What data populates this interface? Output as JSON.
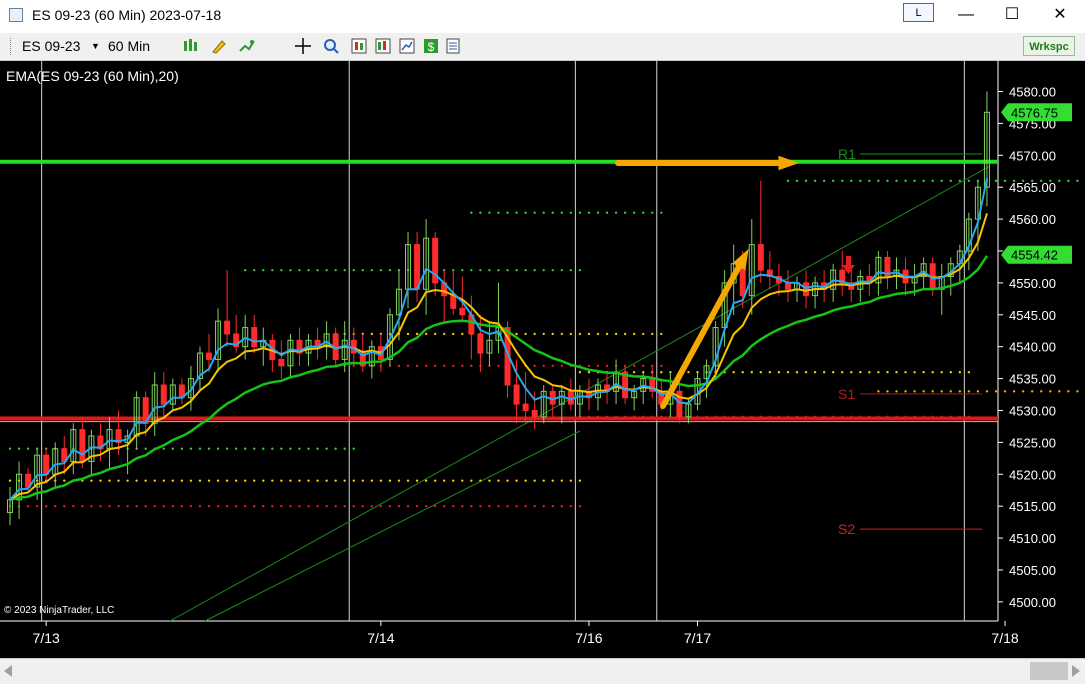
{
  "window": {
    "title": "ES 09-23 (60 Min)  2023-07-18",
    "layout_button": "L",
    "minimize": "—",
    "maximize": "☐",
    "close": "✕"
  },
  "toolbar": {
    "instrument": "ES 09-23",
    "interval": "60 Min",
    "workspace_button": "Wrkspc",
    "icons": [
      "bar-style-icon",
      "drawing-tool-icon",
      "indicator-icon",
      "crosshair-icon",
      "zoom-icon",
      "data-box-icon",
      "chart-trader-icon",
      "strategies-icon",
      "money-icon",
      "properties-icon"
    ]
  },
  "chart": {
    "indicator_label": "EMA(ES 09-23 (60 Min),20)",
    "copyright": "© 2023 NinjaTrader, LLC",
    "price_min": 4497,
    "price_max": 4584,
    "y_ticks": [
      4580,
      4575,
      4570,
      4565,
      4560,
      4555,
      4550,
      4545,
      4540,
      4535,
      4530,
      4525,
      4520,
      4515,
      4510,
      4505,
      4500
    ],
    "x_labels": [
      {
        "label": "7/13",
        "bar": 4
      },
      {
        "label": "7/14",
        "bar": 41
      },
      {
        "label": "7/16",
        "bar": 64
      },
      {
        "label": "7/17",
        "bar": 76
      },
      {
        "label": "7/18",
        "bar": 110
      }
    ],
    "session_lines": [
      3,
      37,
      62,
      71,
      105
    ],
    "last_price_label": "4576.75",
    "ema_price_label": "4554.42",
    "level_lines": [
      {
        "name": "R1",
        "price": 4569,
        "color": "#22e022"
      },
      {
        "name": "S1",
        "price": 4528.75,
        "color": "#e01818"
      }
    ],
    "pivot_labels": [
      {
        "text": "R1",
        "price": 4570.2,
        "color": "#1e8a1e"
      },
      {
        "text": "S1",
        "price": 4532.6,
        "color": "#b31a1a"
      },
      {
        "text": "S2",
        "price": 4511.4,
        "color": "#d12020"
      }
    ],
    "colors": {
      "up_candle": "#7fd35c",
      "down_candle": "#ff2a2a",
      "blue_candle": "#3a6bff",
      "ema_fast": "#2aa7f0",
      "ema_mid": "#f5c400",
      "ema_slow": "#16c416",
      "arrow": "#f5a800",
      "axis_text": "#ffffff"
    },
    "candles": [
      [
        4514,
        4518,
        4512,
        4516
      ],
      [
        4516,
        4522,
        4513,
        4520
      ],
      [
        4520,
        4521,
        4517,
        4518
      ],
      [
        4518,
        4524,
        4516,
        4523
      ],
      [
        4523,
        4524,
        4519,
        4520
      ],
      [
        4520,
        4525,
        4518,
        4524
      ],
      [
        4524,
        4526,
        4520,
        4522
      ],
      [
        4522,
        4528,
        4520,
        4527
      ],
      [
        4527,
        4529,
        4521,
        4522
      ],
      [
        4522,
        4527,
        4520,
        4526
      ],
      [
        4526,
        4528,
        4522,
        4524
      ],
      [
        4524,
        4529,
        4521,
        4527
      ],
      [
        4527,
        4530,
        4523,
        4525
      ],
      [
        4525,
        4527,
        4520,
        4526
      ],
      [
        4526,
        4533,
        4524,
        4532
      ],
      [
        4532,
        4533,
        4526,
        4528
      ],
      [
        4528,
        4536,
        4526,
        4534
      ],
      [
        4534,
        4536,
        4529,
        4531
      ],
      [
        4531,
        4535,
        4530,
        4534
      ],
      [
        4534,
        4535,
        4531,
        4532
      ],
      [
        4532,
        4537,
        4530,
        4535
      ],
      [
        4535,
        4540,
        4533,
        4539
      ],
      [
        4539,
        4542,
        4536,
        4538
      ],
      [
        4538,
        4546,
        4536,
        4544
      ],
      [
        4544,
        4552,
        4540,
        4542
      ],
      [
        4542,
        4545,
        4539,
        4540
      ],
      [
        4540,
        4545,
        4538,
        4543
      ],
      [
        4543,
        4545,
        4539,
        4540
      ],
      [
        4540,
        4543,
        4537,
        4541
      ],
      [
        4541,
        4542,
        4536,
        4538
      ],
      [
        4538,
        4541,
        4535,
        4537
      ],
      [
        4537,
        4542,
        4535,
        4541
      ],
      [
        4541,
        4543,
        4537,
        4539
      ],
      [
        4539,
        4542,
        4537,
        4541
      ],
      [
        4541,
        4543,
        4538,
        4540
      ],
      [
        4540,
        4544,
        4538,
        4542
      ],
      [
        4542,
        4543,
        4537,
        4538
      ],
      [
        4538,
        4544,
        4536,
        4541
      ],
      [
        4541,
        4543,
        4537,
        4539
      ],
      [
        4539,
        4542,
        4536,
        4537
      ],
      [
        4537,
        4541,
        4535,
        4540
      ],
      [
        4540,
        4542,
        4536,
        4538
      ],
      [
        4538,
        4546,
        4537,
        4545
      ],
      [
        4545,
        4552,
        4541,
        4549
      ],
      [
        4549,
        4558,
        4546,
        4556
      ],
      [
        4556,
        4558,
        4547,
        4549
      ],
      [
        4549,
        4560,
        4545,
        4557
      ],
      [
        4557,
        4558,
        4548,
        4550
      ],
      [
        4550,
        4552,
        4544,
        4548
      ],
      [
        4548,
        4552,
        4545,
        4546
      ],
      [
        4546,
        4551,
        4544,
        4545
      ],
      [
        4545,
        4548,
        4538,
        4542
      ],
      [
        4542,
        4545,
        4536,
        4539
      ],
      [
        4539,
        4544,
        4537,
        4541
      ],
      [
        4541,
        4550,
        4539,
        4543
      ],
      [
        4543,
        4544,
        4532,
        4534
      ],
      [
        4534,
        4538,
        4528,
        4531
      ],
      [
        4531,
        4536,
        4528,
        4530
      ],
      [
        4530,
        4533,
        4527,
        4529
      ],
      [
        4529,
        4534,
        4528,
        4533
      ],
      [
        4533,
        4534,
        4529,
        4531
      ],
      [
        4531,
        4534,
        4528,
        4533
      ],
      [
        4533,
        4535,
        4530,
        4531
      ],
      [
        4531,
        4534,
        4529,
        4533
      ],
      [
        4533,
        4535,
        4530,
        4532
      ],
      [
        4532,
        4535,
        4530,
        4534
      ],
      [
        4534,
        4536,
        4531,
        4533
      ],
      [
        4533,
        4538,
        4531,
        4536
      ],
      [
        4536,
        4537,
        4531,
        4532
      ],
      [
        4532,
        4534,
        4530,
        4533
      ],
      [
        4533,
        4536,
        4531,
        4535
      ],
      [
        4535,
        4537,
        4532,
        4533
      ],
      [
        4533,
        4535,
        4530,
        4531
      ],
      [
        4531,
        4536,
        4529,
        4533
      ],
      [
        4533,
        4535,
        4528,
        4529
      ],
      [
        4529,
        4532,
        4528,
        4531
      ],
      [
        4531,
        4536,
        4530,
        4535
      ],
      [
        4535,
        4538,
        4532,
        4537
      ],
      [
        4537,
        4544,
        4535,
        4543
      ],
      [
        4543,
        4552,
        4540,
        4550
      ],
      [
        4550,
        4556,
        4545,
        4553
      ],
      [
        4553,
        4555,
        4546,
        4548
      ],
      [
        4548,
        4560,
        4545,
        4556
      ],
      [
        4556,
        4566,
        4550,
        4552
      ],
      [
        4552,
        4555,
        4549,
        4551
      ],
      [
        4551,
        4553,
        4548,
        4550
      ],
      [
        4550,
        4552,
        4547,
        4549
      ],
      [
        4549,
        4551,
        4547,
        4550
      ],
      [
        4550,
        4552,
        4546,
        4548
      ],
      [
        4548,
        4551,
        4546,
        4550
      ],
      [
        4550,
        4552,
        4547,
        4549
      ],
      [
        4549,
        4553,
        4547,
        4552
      ],
      [
        4552,
        4555,
        4548,
        4550
      ],
      [
        4550,
        4552,
        4547,
        4549
      ],
      [
        4549,
        4552,
        4547,
        4551
      ],
      [
        4551,
        4553,
        4548,
        4550
      ],
      [
        4550,
        4555,
        4548,
        4554
      ],
      [
        4554,
        4555,
        4549,
        4551
      ],
      [
        4551,
        4554,
        4549,
        4552
      ],
      [
        4552,
        4554,
        4548,
        4550
      ],
      [
        4550,
        4553,
        4548,
        4551
      ],
      [
        4551,
        4554,
        4549,
        4553
      ],
      [
        4553,
        4554,
        4548,
        4549
      ],
      [
        4549,
        4553,
        4545,
        4551
      ],
      [
        4551,
        4554,
        4548,
        4553
      ],
      [
        4553,
        4556,
        4550,
        4555
      ],
      [
        4555,
        4561,
        4552,
        4560
      ],
      [
        4560,
        4566,
        4555,
        4565
      ],
      [
        4565,
        4580,
        4562,
        4576.75
      ]
    ]
  }
}
